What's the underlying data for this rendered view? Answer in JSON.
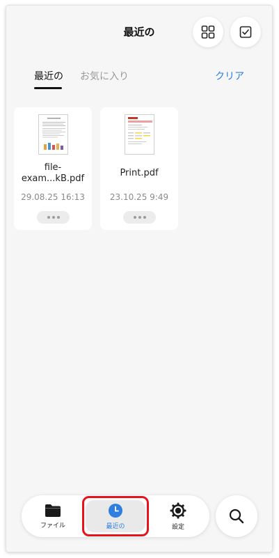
{
  "header": {
    "title": "最近の",
    "grid_view_icon": "grid-icon",
    "select_icon": "checkbox-icon"
  },
  "tabs": {
    "recent_label": "最近の",
    "favorites_label": "お気に入り",
    "clear_label": "クリア"
  },
  "files": [
    {
      "name_line1": "file-",
      "name_line2": "exam...kB.pdf",
      "date": "29.08.25 16:13"
    },
    {
      "name": "Print.pdf",
      "date": "23.10.25 9:49"
    }
  ],
  "tabbar": {
    "files_label": "ファイル",
    "recent_label": "最近の",
    "settings_label": "設定",
    "active": "recent"
  },
  "colors": {
    "accent": "#2f7fe0",
    "highlight": "#e81318",
    "background": "#f6f6f6"
  }
}
